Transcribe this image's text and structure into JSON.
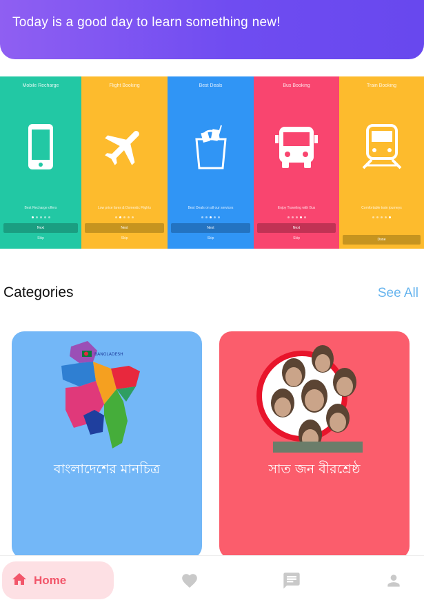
{
  "header": {
    "greeting": "Today is a good day to learn something new!",
    "gradient_start": "#8f5ff2",
    "gradient_end": "#6848ee"
  },
  "promo_banner": {
    "cards": [
      {
        "title": "Mobile Recharge",
        "icon": "smartphone-icon",
        "caption": "Best Recharge offers",
        "color": "#22c8a4",
        "button_color": "#1a9e81",
        "next_label": "Next",
        "skip_label": "Skip",
        "active_dot": 0
      },
      {
        "title": "Flight Booking",
        "icon": "airplane-icon",
        "caption": "Low price fares & Domestic Flights",
        "color": "#fdbb2d",
        "button_color": "#c6941f",
        "next_label": "Next",
        "skip_label": "Skip",
        "active_dot": 1
      },
      {
        "title": "Best Deals",
        "icon": "shopping-bag-icon",
        "caption": "Best Deals on all our services",
        "color": "#3095f5",
        "button_color": "#2373c1",
        "next_label": "Next",
        "skip_label": "Skip",
        "active_dot": 2
      },
      {
        "title": "Bus Booking",
        "icon": "bus-icon",
        "caption": "Enjoy Traveling with Bus",
        "color": "#f9456f",
        "button_color": "#c13254",
        "next_label": "Next",
        "skip_label": "Skip",
        "active_dot": 3
      },
      {
        "title": "Train Booking",
        "icon": "train-icon",
        "caption": "Comfortable train journeys",
        "color": "#fdbb2d",
        "button_color": "#c6941f",
        "next_label": "",
        "skip_label": "Done",
        "active_dot": 4
      }
    ]
  },
  "categories": {
    "title": "Categories",
    "see_all": "See All",
    "items": [
      {
        "label": "বাংলাদেশের মানচিত্র",
        "image": "bangladesh-map-image",
        "color": "#73b7f7"
      },
      {
        "label": "সাত জন বীরশ্রেষ্ঠ",
        "image": "seven-heroes-portrait-image",
        "color": "#fb5d6c"
      }
    ]
  },
  "bottom_nav": {
    "home_label": "Home",
    "active_color": "#f2566a",
    "inactive_color": "#c9c9c9",
    "items": [
      "home-icon",
      "heart-icon",
      "chat-icon",
      "profile-icon"
    ]
  }
}
